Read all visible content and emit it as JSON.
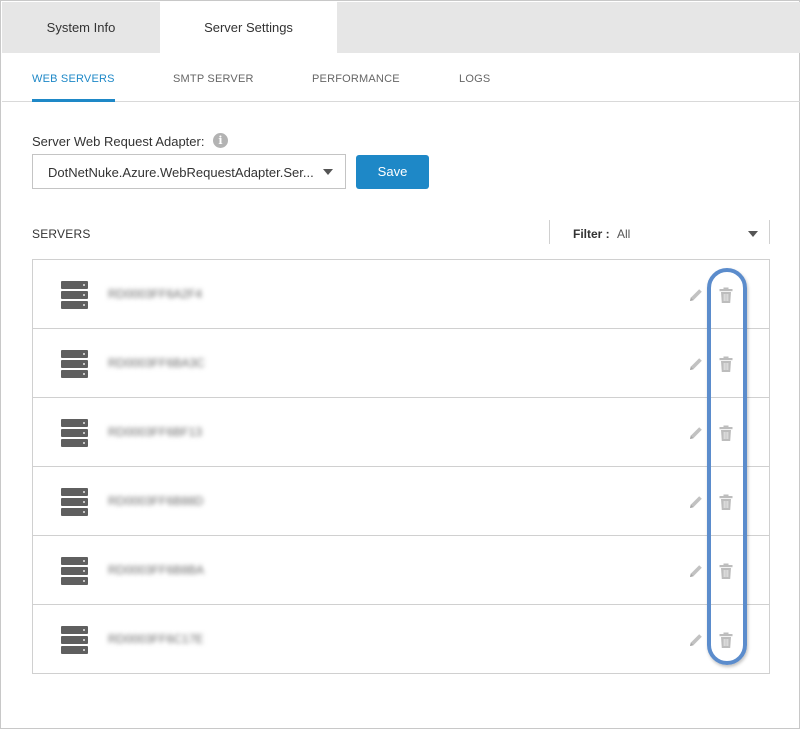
{
  "top_tabs": [
    {
      "label": "System Info",
      "active": false
    },
    {
      "label": "Server Settings",
      "active": true
    }
  ],
  "sub_tabs": [
    {
      "label": "WEB SERVERS",
      "active": true
    },
    {
      "label": "SMTP SERVER",
      "active": false
    },
    {
      "label": "PERFORMANCE",
      "active": false
    },
    {
      "label": "LOGS",
      "active": false
    }
  ],
  "adapter": {
    "label": "Server Web Request Adapter:",
    "info_icon": "info-icon",
    "selected_value": "DotNetNuke.Azure.WebRequestAdapter.Ser...",
    "save_label": "Save"
  },
  "servers": {
    "title": "SERVERS",
    "filter_label": "Filter :",
    "filter_value": "All",
    "rows": [
      {
        "name": "RD0003FF6A2F4",
        "icon": "server-icon",
        "actions": [
          "edit-icon",
          "trash-icon"
        ]
      },
      {
        "name": "RD0003FF6BA3C",
        "icon": "server-icon",
        "actions": [
          "edit-icon",
          "trash-icon"
        ]
      },
      {
        "name": "RD0003FF6BF13",
        "icon": "server-icon",
        "actions": [
          "edit-icon",
          "trash-icon"
        ]
      },
      {
        "name": "RD0003FF6B88D",
        "icon": "server-icon",
        "actions": [
          "edit-icon",
          "trash-icon"
        ]
      },
      {
        "name": "RD0003FF6B8BA",
        "icon": "server-icon",
        "actions": [
          "edit-icon",
          "trash-icon"
        ]
      },
      {
        "name": "RD0003FF6C17E",
        "icon": "server-icon",
        "actions": [
          "edit-icon",
          "trash-icon"
        ]
      }
    ]
  },
  "colors": {
    "accent": "#1e88c7",
    "highlight": "#5b8ccc",
    "icon_gray": "#bdbdbd",
    "server_icon": "#5f5f5f"
  }
}
